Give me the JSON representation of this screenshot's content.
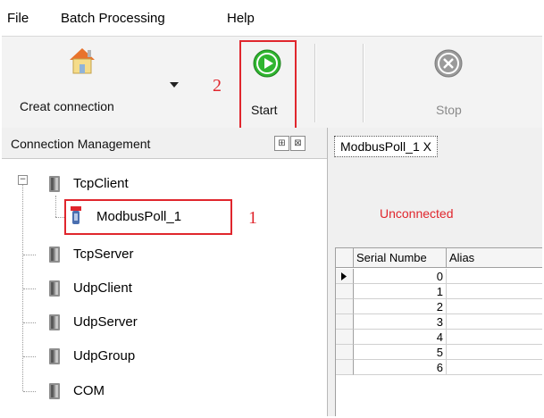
{
  "menu": [
    "File",
    "Batch Processing",
    "Help"
  ],
  "toolbar": {
    "create_label": "Creat connection",
    "start_label": "Start",
    "stop_label": "Stop"
  },
  "annotations": {
    "one": "1",
    "two": "2"
  },
  "connection_panel": {
    "title": "Connection Management",
    "pin": "⊞",
    "close": "⊠",
    "expander": "−",
    "tree": {
      "tcp_client": "TcpClient",
      "modbus_poll": "ModbusPoll_1",
      "tcp_server": "TcpServer",
      "udp_client": "UdpClient",
      "udp_server": "UdpServer",
      "udp_group": "UdpGroup",
      "com": "COM"
    }
  },
  "document": {
    "tab_label": "ModbusPoll_1 X",
    "status": "Unconnected",
    "columns": [
      "Serial Numbe",
      "Alias"
    ],
    "rows": [
      "0",
      "1",
      "2",
      "3",
      "4",
      "5",
      "6"
    ]
  },
  "colors": {
    "accent_red": "#e0262d",
    "start_green": "#2fb52f"
  }
}
